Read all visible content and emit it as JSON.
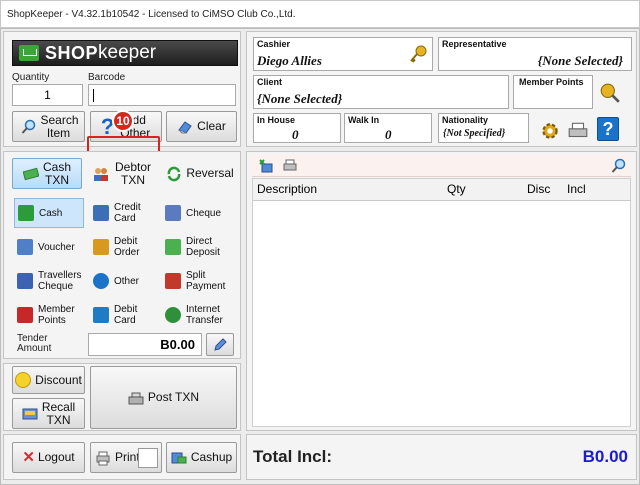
{
  "window": {
    "title": "ShopKeeper - V4.32.1b10542 - Licensed to CiMSO Club Co.,Ltd."
  },
  "logo": {
    "brand_bold": "SHOP",
    "brand_light": "keeper"
  },
  "entry": {
    "quantity_label": "Quantity",
    "quantity_value": "1",
    "barcode_label": "Barcode",
    "barcode_value": ""
  },
  "actions": {
    "search_item": "Search Item",
    "add_other": "Add Other",
    "clear": "Clear"
  },
  "step_badge": "10",
  "txn_types": {
    "cash": "Cash TXN",
    "debtor": "Debtor TXN",
    "reversal": "Reversal"
  },
  "tender_options": [
    {
      "label": "Cash",
      "icon": "cash-icon",
      "color": "#2e9b3a"
    },
    {
      "label": "Credit Card",
      "icon": "credit-card-icon",
      "color": "#3d6fb6"
    },
    {
      "label": "Cheque",
      "icon": "cheque-icon",
      "color": "#5a7bbf"
    },
    {
      "label": "Voucher",
      "icon": "voucher-icon",
      "color": "#4f7fc7"
    },
    {
      "label": "Debit Order",
      "icon": "debit-order-icon",
      "color": "#d79a1d"
    },
    {
      "label": "Direct Deposit",
      "icon": "direct-deposit-icon",
      "color": "#4caf50"
    },
    {
      "label": "Travellers Cheque",
      "icon": "travellers-cheque-icon",
      "color": "#3b63b0"
    },
    {
      "label": "Other",
      "icon": "question-icon",
      "color": "#1a73c9"
    },
    {
      "label": "Split Payment",
      "icon": "split-payment-icon",
      "color": "#c0392b"
    },
    {
      "label": "Member Points",
      "icon": "member-points-icon",
      "color": "#c62828"
    },
    {
      "label": "Debit Card",
      "icon": "debit-card-icon",
      "color": "#1e7bc4"
    },
    {
      "label": "Internet Transfer",
      "icon": "globe-icon",
      "color": "#2f8f3a"
    }
  ],
  "tender": {
    "label": "Tender Amount",
    "value": "B0.00"
  },
  "bottom_left": {
    "discount": "Discount",
    "recall": "Recall TXN",
    "post": "Post TXN"
  },
  "footer": {
    "logout": "Logout",
    "print": "Print",
    "cashup": "Cashup"
  },
  "info": {
    "cashier_label": "Cashier",
    "cashier_value": "Diego Allies",
    "rep_label": "Representative",
    "rep_value": "{None Selected}",
    "client_label": "Client",
    "client_value": "{None Selected}",
    "member_points_label": "Member Points",
    "inhouse_label": "In House",
    "inhouse_value": "0",
    "walkin_label": "Walk In",
    "walkin_value": "0",
    "nationality_label": "Nationality",
    "nationality_value": "{Not Specified}"
  },
  "table": {
    "headers": [
      "Description",
      "Qty",
      "Disc",
      "Incl"
    ]
  },
  "total": {
    "label": "Total Incl:",
    "value": "B0.00"
  },
  "colors": {
    "accent_blue": "#1a1ad8",
    "badge_red": "#d8261c"
  }
}
